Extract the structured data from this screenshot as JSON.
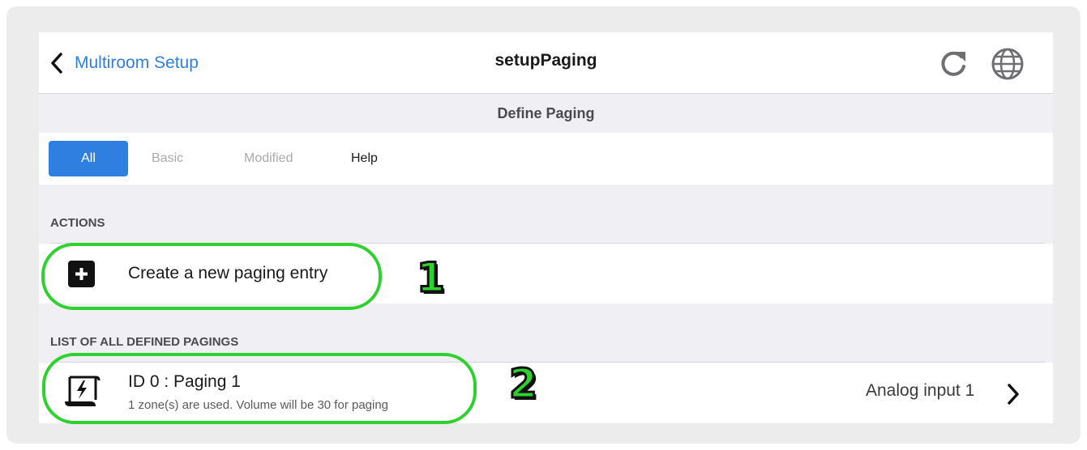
{
  "nav": {
    "back_label": "Multiroom Setup",
    "title": "setupPaging",
    "refresh_icon": "refresh-icon",
    "globe_icon": "globe-icon"
  },
  "section": {
    "title": "Define Paging"
  },
  "tabs": [
    {
      "label": "All",
      "active": true
    },
    {
      "label": "Basic",
      "active": false
    },
    {
      "label": "Modified",
      "active": false
    },
    {
      "label": "Help",
      "active": false
    }
  ],
  "actions": {
    "header": "ACTIONS",
    "create": {
      "label": "Create a new paging entry",
      "icon": "plus-square-icon"
    }
  },
  "pagings": {
    "header": "LIST OF ALL DEFINED PAGINGS",
    "items": [
      {
        "title": "ID 0 : Paging 1",
        "subtitle": "1 zone(s) are used. Volume will be 30 for paging",
        "value": "Analog input 1",
        "icon": "paging-scroll-icon"
      }
    ]
  },
  "annotations": [
    {
      "label": "1",
      "color": "#2fd12f"
    },
    {
      "label": "2",
      "color": "#2fd12f"
    }
  ],
  "colors": {
    "accent": "#2f7fe0",
    "highlight": "#2fd12f",
    "background": "#efeff4"
  }
}
